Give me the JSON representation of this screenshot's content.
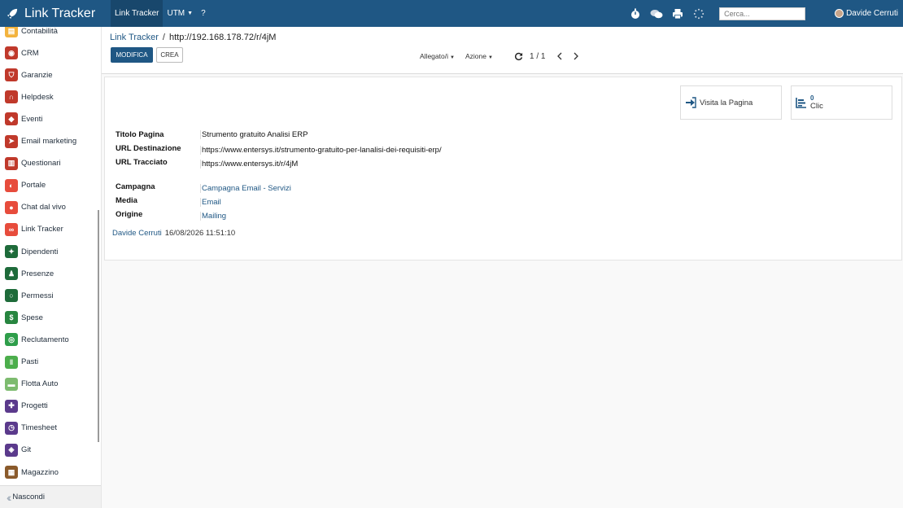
{
  "app": {
    "name": "Link Tracker"
  },
  "topbar": {
    "menu": [
      {
        "label": "Link Tracker",
        "active": true
      },
      {
        "label": "UTM",
        "has_caret": true
      },
      {
        "label": "?"
      }
    ],
    "search_placeholder": "Cerca...",
    "user_name": "Davide Cerruti"
  },
  "sidebar": {
    "items": [
      {
        "label": "Contabilità",
        "icon": "accounting-icon",
        "color": "#f3b33d"
      },
      {
        "label": "CRM",
        "icon": "crm-icon",
        "color": "#c0392b"
      },
      {
        "label": "Garanzie",
        "icon": "shield-icon",
        "color": "#c0392b"
      },
      {
        "label": "Helpdesk",
        "icon": "headset-icon",
        "color": "#c0392b"
      },
      {
        "label": "Eventi",
        "icon": "ticket-icon",
        "color": "#c0392b"
      },
      {
        "label": "Email marketing",
        "icon": "paper-plane-icon",
        "color": "#c0392b"
      },
      {
        "label": "Questionari",
        "icon": "survey-icon",
        "color": "#c0392b"
      },
      {
        "label": "Portale",
        "icon": "portal-icon",
        "color": "#e74c3c"
      },
      {
        "label": "Chat dal vivo",
        "icon": "chat-icon",
        "color": "#e74c3c"
      },
      {
        "label": "Link Tracker",
        "icon": "link-icon",
        "color": "#e74c3c"
      },
      {
        "label": "Dipendenti",
        "icon": "users-icon",
        "color": "#1e6b3a"
      },
      {
        "label": "Presenze",
        "icon": "user-check-icon",
        "color": "#1e6b3a"
      },
      {
        "label": "Permessi",
        "icon": "calendar-icon",
        "color": "#1e6b3a"
      },
      {
        "label": "Spese",
        "icon": "dollar-icon",
        "color": "#27853f"
      },
      {
        "label": "Reclutamento",
        "icon": "search-person-icon",
        "color": "#2e9e4a"
      },
      {
        "label": "Pasti",
        "icon": "cutlery-icon",
        "color": "#4cae4c"
      },
      {
        "label": "Flotta Auto",
        "icon": "car-icon",
        "color": "#7dbb6f"
      },
      {
        "label": "Progetti",
        "icon": "puzzle-icon",
        "color": "#5b3a8c"
      },
      {
        "label": "Timesheet",
        "icon": "clock-icon",
        "color": "#5b3a8c"
      },
      {
        "label": "Git",
        "icon": "git-icon",
        "color": "#5b3a8c"
      },
      {
        "label": "Magazzino",
        "icon": "warehouse-icon",
        "color": "#8a5a2b"
      }
    ],
    "footer_label": "Nascondi"
  },
  "control": {
    "breadcrumb_parent": "Link Tracker",
    "breadcrumb_separator": "/",
    "breadcrumb_current": "http://192.168.178.72/r/4jM",
    "edit_label": "MODIFICA",
    "create_label": "CREA",
    "attachment_label": "Allegato/i",
    "action_label": "Azione",
    "pager_text": "1 / 1"
  },
  "sheet": {
    "visit_label": "Visita la Pagina",
    "clicks_value": "0",
    "clicks_label": "Clic",
    "fields": [
      {
        "label": "Titolo Pagina",
        "value": "Strumento gratuito Analisi ERP",
        "link": false
      },
      {
        "label": "URL Destinazione",
        "value": "https://www.entersys.it/strumento-gratuito-per-lanalisi-dei-requisiti-erp/",
        "link": false
      },
      {
        "label": "URL Tracciato",
        "value": "https://www.entersys.it/r/4jM",
        "link": false
      },
      {
        "label": "Campagna",
        "value": "Campagna Email - Servizi",
        "link": true
      },
      {
        "label": "Media",
        "value": "Email",
        "link": true
      },
      {
        "label": "Origine",
        "value": "Mailing",
        "link": true
      }
    ],
    "created_by": "Davide Cerruti",
    "created_on": "16/08/2026 11:51:10"
  },
  "colors": {
    "brand": "#1f5784",
    "topbar": "#1f5784"
  }
}
